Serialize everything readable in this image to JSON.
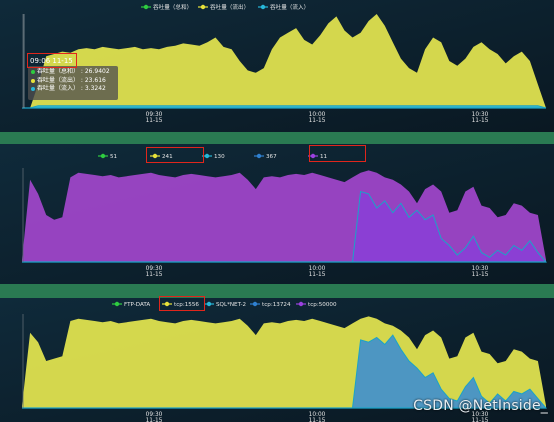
{
  "colors": {
    "panel_bg": "#0d2333",
    "strip": "#2a7a52",
    "baseline": "#1aa3c8",
    "yellow": "#dfe24f",
    "purple": "#9e46c8",
    "blue": "#3e8fcf",
    "legend_green": "#2ecc40",
    "legend_yellow": "#e8e23a",
    "legend_cyan": "#27b7d8",
    "legend_blue": "#2f80d0",
    "legend_purple": "#9b41e0",
    "highlight_box": "#e0261c"
  },
  "tooltip": {
    "title": "09:06 11-15",
    "rows": [
      {
        "label": "吞吐量（总和）",
        "value": "26.9402",
        "color": "#2ecc40"
      },
      {
        "label": "吞吐量（流出）",
        "value": "23.616",
        "color": "#e8e23a"
      },
      {
        "label": "吞吐量（流入）",
        "value": "3.3242",
        "color": "#27b7d8"
      }
    ]
  },
  "watermark": "CSDN @NetInside_",
  "chart_data": [
    {
      "type": "area",
      "legend": [
        "吞吐量（总和）",
        "吞吐量（流出）",
        "吞吐量（流入）"
      ],
      "x_ticks": [
        {
          "time": "09:30",
          "date": "11-15"
        },
        {
          "time": "10:00",
          "date": "11-15"
        },
        {
          "time": "10:30",
          "date": "11-15"
        }
      ],
      "grid": false,
      "legend_position": "top-center",
      "series": [
        {
          "name": "吞吐量（流出）",
          "color": "#dfe24f",
          "values": [
            0,
            0,
            20,
            44,
            46,
            48,
            47,
            50,
            51,
            50,
            52,
            51,
            50,
            51,
            52,
            50,
            51,
            50,
            52,
            53,
            55,
            54,
            53,
            56,
            60,
            52,
            50,
            40,
            32,
            30,
            34,
            50,
            60,
            64,
            68,
            58,
            54,
            62,
            72,
            78,
            66,
            60,
            64,
            74,
            80,
            70,
            56,
            42,
            34,
            30,
            50,
            60,
            56,
            40,
            36,
            42,
            52,
            56,
            50,
            46,
            38,
            44,
            48,
            40,
            20,
            0
          ]
        },
        {
          "name": "吞吐量（流入）",
          "color": "#27b7d8",
          "values": [
            0,
            0,
            2,
            2,
            2,
            2,
            2,
            2,
            2,
            2,
            2,
            2,
            2,
            2,
            2,
            2,
            2,
            2,
            2,
            2,
            2,
            2,
            2,
            2,
            2,
            2,
            2,
            2,
            2,
            2,
            2,
            2,
            2,
            2,
            2,
            2,
            2,
            2,
            2,
            2,
            2,
            2,
            2,
            2,
            2,
            2,
            2,
            2,
            2,
            2,
            2,
            2,
            2,
            2,
            2,
            2,
            2,
            2,
            2,
            2,
            2,
            2,
            2,
            2,
            2,
            0
          ]
        }
      ]
    },
    {
      "type": "area",
      "legend": [
        "51",
        "241",
        "130",
        "367",
        "11"
      ],
      "x_ticks": [
        {
          "time": "09:30",
          "date": "11-15"
        },
        {
          "time": "10:00",
          "date": "11-15"
        },
        {
          "time": "10:30",
          "date": "11-15"
        }
      ],
      "grid": false,
      "legend_position": "top-center",
      "series": [
        {
          "name": "241",
          "color": "#9e46c8",
          "values": [
            2,
            70,
            58,
            40,
            36,
            38,
            72,
            76,
            75,
            74,
            73,
            74,
            72,
            73,
            74,
            75,
            76,
            74,
            73,
            72,
            74,
            75,
            74,
            73,
            72,
            73,
            74,
            76,
            70,
            62,
            72,
            73,
            72,
            74,
            75,
            74,
            76,
            74,
            72,
            70,
            68,
            72,
            76,
            78,
            76,
            72,
            70,
            66,
            60,
            50,
            62,
            66,
            60,
            42,
            44,
            60,
            64,
            48,
            46,
            38,
            40,
            50,
            48,
            42,
            40,
            2
          ]
        },
        {
          "name": "11",
          "color": "#9e46c8",
          "values": [
            0,
            0,
            0,
            0,
            0,
            0,
            0,
            0,
            0,
            0,
            0,
            0,
            0,
            0,
            0,
            0,
            0,
            0,
            0,
            0,
            0,
            0,
            0,
            0,
            0,
            0,
            0,
            0,
            0,
            0,
            0,
            0,
            0,
            0,
            0,
            0,
            0,
            0,
            0,
            0,
            0,
            0,
            60,
            58,
            46,
            52,
            42,
            50,
            38,
            44,
            36,
            40,
            20,
            14,
            6,
            12,
            22,
            8,
            4,
            10,
            6,
            14,
            10,
            18,
            8,
            0
          ]
        }
      ]
    },
    {
      "type": "area",
      "legend": [
        "FTP-DATA",
        "tcp:1556",
        "SQL*NET-2",
        "tcp:13724",
        "tcp:50000"
      ],
      "x_ticks": [
        {
          "time": "09:30",
          "date": "11-15"
        },
        {
          "time": "10:00",
          "date": "11-15"
        },
        {
          "time": "10:30",
          "date": "11-15"
        }
      ],
      "grid": false,
      "legend_position": "top-center",
      "series": [
        {
          "name": "tcp:1556",
          "color": "#dfe24f",
          "values": [
            2,
            64,
            56,
            40,
            42,
            44,
            74,
            76,
            75,
            74,
            73,
            74,
            72,
            73,
            74,
            75,
            76,
            74,
            73,
            72,
            74,
            75,
            74,
            73,
            72,
            73,
            74,
            76,
            70,
            62,
            72,
            73,
            72,
            74,
            75,
            74,
            76,
            74,
            72,
            70,
            68,
            72,
            76,
            78,
            76,
            72,
            70,
            66,
            60,
            50,
            62,
            66,
            60,
            42,
            44,
            60,
            64,
            48,
            46,
            38,
            40,
            50,
            48,
            42,
            40,
            2
          ]
        },
        {
          "name": "tcp:13724",
          "color": "#3e8fcf",
          "values": [
            0,
            0,
            0,
            0,
            0,
            0,
            0,
            0,
            0,
            0,
            0,
            0,
            0,
            0,
            0,
            0,
            0,
            0,
            0,
            0,
            0,
            0,
            0,
            0,
            0,
            0,
            0,
            0,
            0,
            0,
            0,
            0,
            0,
            0,
            0,
            0,
            0,
            0,
            0,
            0,
            0,
            0,
            58,
            56,
            60,
            54,
            62,
            50,
            40,
            34,
            26,
            30,
            16,
            8,
            6,
            18,
            26,
            10,
            4,
            12,
            6,
            14,
            12,
            16,
            8,
            0
          ]
        }
      ]
    }
  ]
}
